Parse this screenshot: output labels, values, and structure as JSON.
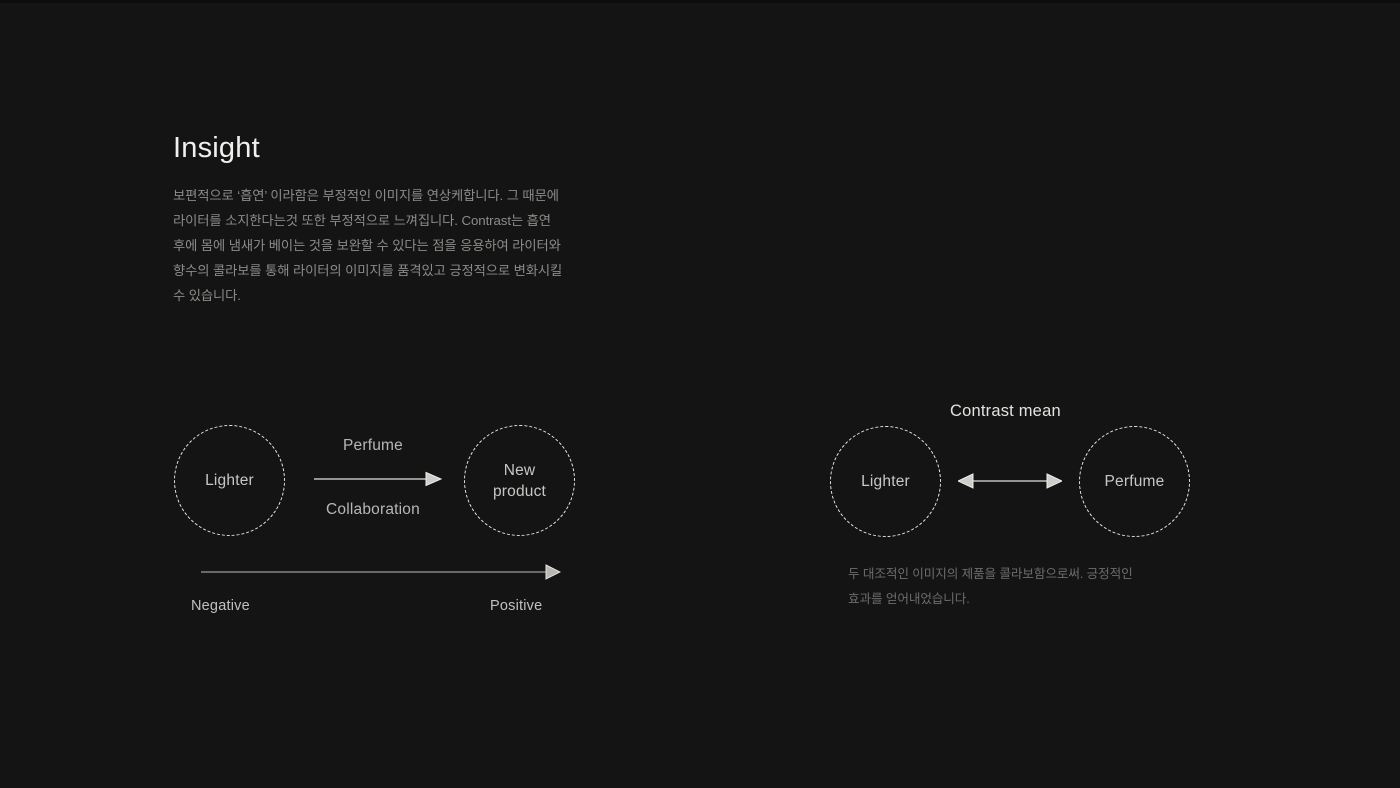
{
  "page": {
    "background_color": "#141414",
    "text_color_primary": "#f2f0ee",
    "text_color_muted": "#8d8b88"
  },
  "insight": {
    "title": "Insight",
    "body_lines": [
      "보편적으로 ‘흡연’ 이라함은 부정적인 이미지를 연상케합니다. 그 때문에",
      "라이터를 소지한다는것 또한 부정적으로 느껴집니다. Contrast는 흡연",
      "후에 몸에 냄새가 베이는 것을 보완할 수 있다는 점을 응용하여 라이터와",
      "향수의 콜라보를 통해 라이터의 이미지를 품격있고 긍정적으로 변화시킬",
      "수 있습니다."
    ]
  },
  "diagram_left": {
    "node_source": "Lighter",
    "node_target_line1": "New",
    "node_target_line2": "product",
    "flow_label_top": "Perfume",
    "flow_label_bottom": "Collaboration",
    "axis_start": "Negative",
    "axis_end": "Positive"
  },
  "diagram_right": {
    "title": "Contrast mean",
    "node_left": "Lighter",
    "node_right": "Perfume",
    "caption_lines": [
      "두 대조적인 이미지의 제품을 콜라보함으로써. 긍정적인",
      "효과를 얻어내었습니다."
    ]
  }
}
